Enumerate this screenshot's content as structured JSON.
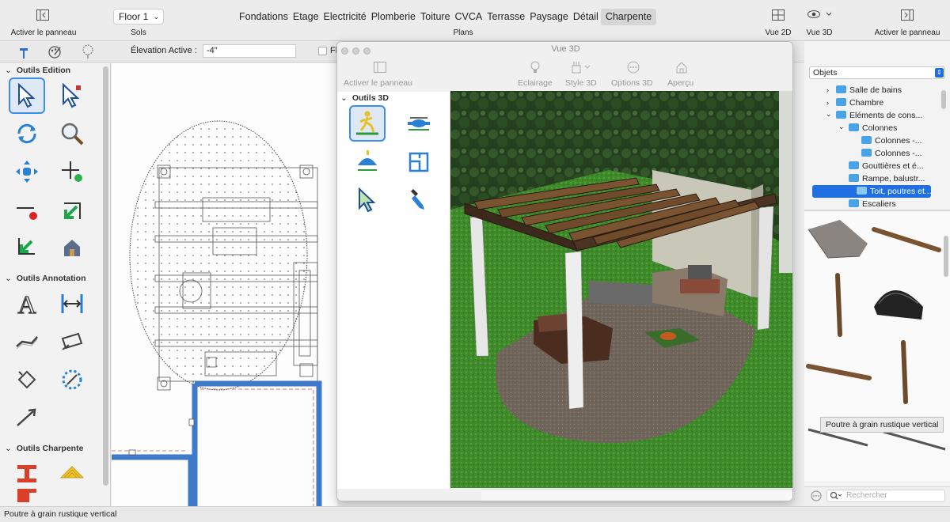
{
  "toolbar": {
    "left_panel_label": "Activer le panneau",
    "floor_select": "Floor 1",
    "floor_label": "Sols",
    "plans": [
      "Fondations",
      "Etage",
      "Electricité",
      "Plomberie",
      "Toiture",
      "CVCA",
      "Terrasse",
      "Paysage",
      "Détail",
      "Charpente"
    ],
    "plans_active": "Charpente",
    "plans_label": "Plans",
    "view2d_label": "Vue 2D",
    "view3d_label": "Vue 3D",
    "right_panel_label": "Activer le panneau"
  },
  "options": {
    "elevation_label": "Élevation Active :",
    "elevation_value": "-4\"",
    "checkbox_label": "Fl"
  },
  "left_palette": {
    "sections": [
      "Outils Edition",
      "Outils Annotation",
      "Outils Charpente"
    ]
  },
  "view3d": {
    "title": "Vue 3D",
    "toolbar": [
      "Activer le panneau",
      "Eclairage",
      "Style 3D",
      "Options 3D",
      "Aperçu"
    ],
    "tools_section": "Outils 3D"
  },
  "right_panel": {
    "category": "Objets",
    "tree": [
      {
        "label": "Salle de bains",
        "level": 1,
        "expanded": false
      },
      {
        "label": "Chambre",
        "level": 1,
        "expanded": false
      },
      {
        "label": "Eléments de cons...",
        "level": 1,
        "expanded": true
      },
      {
        "label": "Colonnes",
        "level": 2,
        "expanded": true
      },
      {
        "label": "Colonnes -...",
        "level": 3
      },
      {
        "label": "Colonnes -...",
        "level": 3
      },
      {
        "label": "Gouttières et é...",
        "level": 2
      },
      {
        "label": "Rampe, balustr...",
        "level": 2
      },
      {
        "label": "Toit, poutres et...",
        "level": 2,
        "selected": true
      },
      {
        "label": "Escaliers",
        "level": 2
      }
    ],
    "tooltip": "Poutre à grain rustique vertical",
    "search_placeholder": "Rechercher"
  },
  "status": "Poutre à grain rustique vertical",
  "colors": {
    "accent": "#1f6fe0",
    "selection": "#3a8ee6",
    "wall": "#3f79c9",
    "plan_line": "#555555"
  }
}
